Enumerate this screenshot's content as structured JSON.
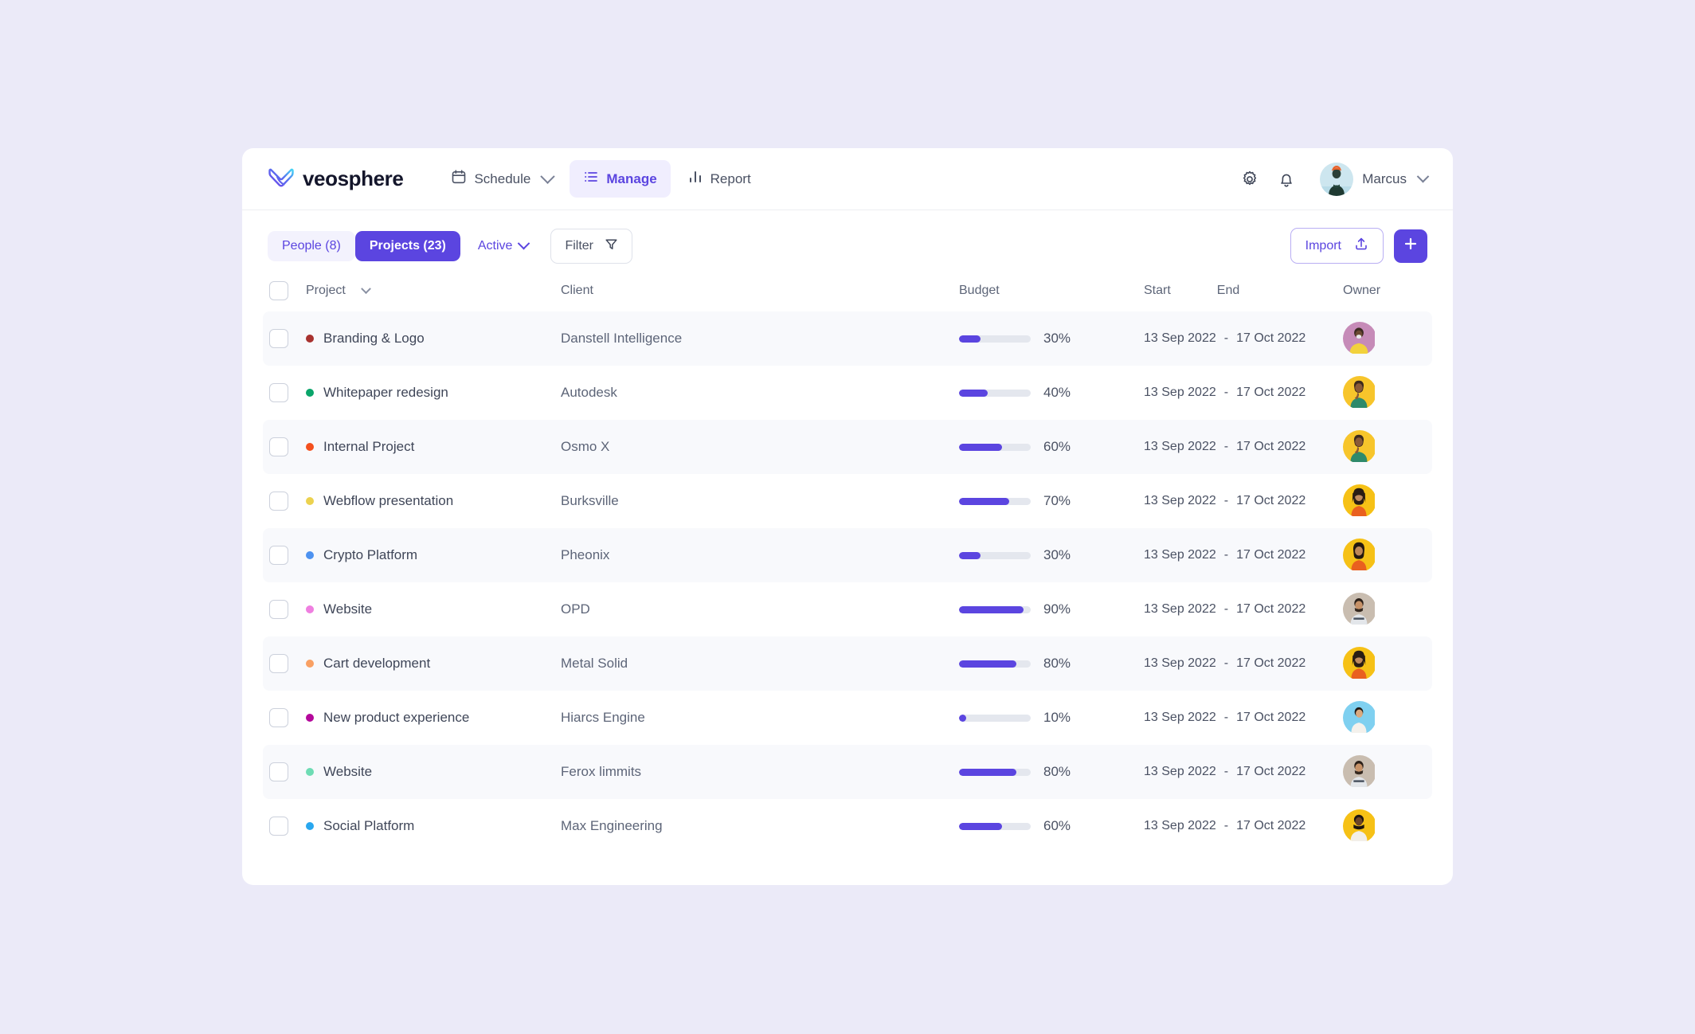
{
  "brand": {
    "name": "veosphere",
    "logo_icon": "veosphere-wing-logo"
  },
  "nav": {
    "items": [
      {
        "label": "Schedule",
        "icon": "calendar-icon",
        "active": false,
        "has_chevron": true
      },
      {
        "label": "Manage",
        "icon": "list-icon",
        "active": true,
        "has_chevron": false
      },
      {
        "label": "Report",
        "icon": "bar-chart-icon",
        "active": false,
        "has_chevron": false
      }
    ]
  },
  "header_right": {
    "settings_icon": "gear-icon",
    "notifications_icon": "bell-icon",
    "user_name": "Marcus",
    "user_chevron_icon": "chevron-down-icon",
    "avatar_icon": "user-avatar"
  },
  "toolbar": {
    "people_label": "People (8)",
    "projects_label": "Projects (23)",
    "status_label": "Active",
    "status_chevron_icon": "chevron-down-icon",
    "filter_label": "Filter",
    "filter_icon": "funnel-icon",
    "import_label": "Import",
    "import_icon": "upload-icon",
    "add_icon": "plus-icon"
  },
  "table": {
    "headers": {
      "select": "",
      "project": "Project",
      "client": "Client",
      "budget": "Budget",
      "start": "Start",
      "end": "End",
      "owner": "Owner"
    },
    "sort_icon": "chevron-down-icon",
    "rows": [
      {
        "project": "Branding & Logo",
        "dot": "#a8322f",
        "client": "Danstell Intelligence",
        "budget_pct": 30,
        "budget_label": "30%",
        "start": "13 Sep 2022",
        "separator": "-",
        "end": "17 Oct 2022",
        "avatar_bg": "#c68bb8",
        "avatar_variant": "a"
      },
      {
        "project": "Whitepaper redesign",
        "dot": "#0aa56a",
        "client": "Autodesk",
        "budget_pct": 40,
        "budget_label": "40%",
        "start": "13 Sep 2022",
        "separator": "-",
        "end": "17 Oct 2022",
        "avatar_bg": "#f7c52b",
        "avatar_variant": "b"
      },
      {
        "project": "Internal Project",
        "dot": "#f4501e",
        "client": "Osmo X",
        "budget_pct": 60,
        "budget_label": "60%",
        "start": "13 Sep 2022",
        "separator": "-",
        "end": "17 Oct 2022",
        "avatar_bg": "#f7c52b",
        "avatar_variant": "b"
      },
      {
        "project": "Webflow presentation",
        "dot": "#ecd24f",
        "client": "Burksville",
        "budget_pct": 70,
        "budget_label": "70%",
        "start": "13 Sep 2022",
        "separator": "-",
        "end": "17 Oct 2022",
        "avatar_bg": "#f6c116",
        "avatar_variant": "c"
      },
      {
        "project": "Crypto Platform",
        "dot": "#4d92f0",
        "client": "Pheonix",
        "budget_pct": 30,
        "budget_label": "30%",
        "start": "13 Sep 2022",
        "separator": "-",
        "end": "17 Oct 2022",
        "avatar_bg": "#f6c116",
        "avatar_variant": "d"
      },
      {
        "project": "Website",
        "dot": "#ef7fe0",
        "client": "OPD",
        "budget_pct": 90,
        "budget_label": "90%",
        "start": "13 Sep 2022",
        "separator": "-",
        "end": "17 Oct 2022",
        "avatar_bg": "#c9bdb0",
        "avatar_variant": "e"
      },
      {
        "project": "Cart development",
        "dot": "#f9a063",
        "client": "Metal Solid",
        "budget_pct": 80,
        "budget_label": "80%",
        "start": "13 Sep 2022",
        "separator": "-",
        "end": "17 Oct 2022",
        "avatar_bg": "#f6c116",
        "avatar_variant": "c"
      },
      {
        "project": "New product experience",
        "dot": "#b4089b",
        "client": "Hiarcs Engine",
        "budget_pct": 10,
        "budget_label": "10%",
        "start": "13 Sep 2022",
        "separator": "-",
        "end": "17 Oct 2022",
        "avatar_bg": "#7fd0f0",
        "avatar_variant": "f"
      },
      {
        "project": "Website",
        "dot": "#6edcb4",
        "client": "Ferox limmits",
        "budget_pct": 80,
        "budget_label": "80%",
        "start": "13 Sep 2022",
        "separator": "-",
        "end": "17 Oct 2022",
        "avatar_bg": "#c9bdb0",
        "avatar_variant": "e"
      },
      {
        "project": "Social Platform",
        "dot": "#29a7ef",
        "client": "Max Engineering",
        "budget_pct": 60,
        "budget_label": "60%",
        "start": "13 Sep 2022",
        "separator": "-",
        "end": "17 Oct 2022",
        "avatar_bg": "#f6c116",
        "avatar_variant": "g"
      }
    ]
  },
  "colors": {
    "accent": "#5b45e0",
    "page_bg": "#ebeaf8",
    "card_bg": "#ffffff",
    "row_alt_bg": "#f8f9fc",
    "track": "#e4e7ee"
  }
}
